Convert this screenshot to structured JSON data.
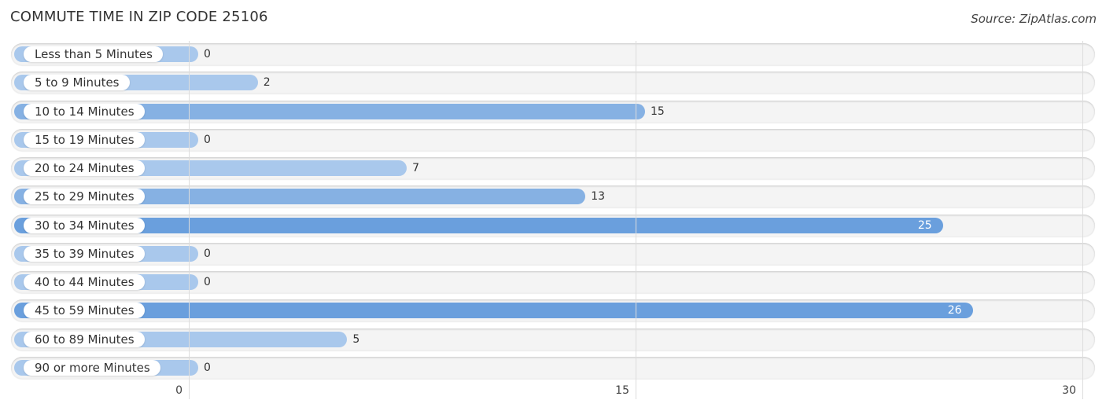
{
  "title": "COMMUTE TIME IN ZIP CODE 25106",
  "source": "Source: ZipAtlas.com",
  "colors": {
    "bar_light": "#a9c8ec",
    "bar_mid": "#86b1e3",
    "bar_strong": "#6a9fdd",
    "track": "#f4f4f4"
  },
  "chart_data": {
    "type": "bar",
    "orientation": "horizontal",
    "title": "COMMUTE TIME IN ZIP CODE 25106",
    "xlabel": "",
    "ylabel": "",
    "xlim": [
      0,
      30
    ],
    "x_ticks": [
      "0",
      "15",
      "30"
    ],
    "grid": true,
    "categories": [
      "Less than 5 Minutes",
      "5 to 9 Minutes",
      "10 to 14 Minutes",
      "15 to 19 Minutes",
      "20 to 24 Minutes",
      "25 to 29 Minutes",
      "30 to 34 Minutes",
      "35 to 39 Minutes",
      "40 to 44 Minutes",
      "45 to 59 Minutes",
      "60 to 89 Minutes",
      "90 or more Minutes"
    ],
    "values": [
      0,
      2,
      15,
      0,
      7,
      13,
      25,
      0,
      0,
      26,
      5,
      0
    ],
    "value_labels": [
      "0",
      "2",
      "15",
      "0",
      "7",
      "13",
      "25",
      "0",
      "0",
      "26",
      "5",
      "0"
    ]
  }
}
